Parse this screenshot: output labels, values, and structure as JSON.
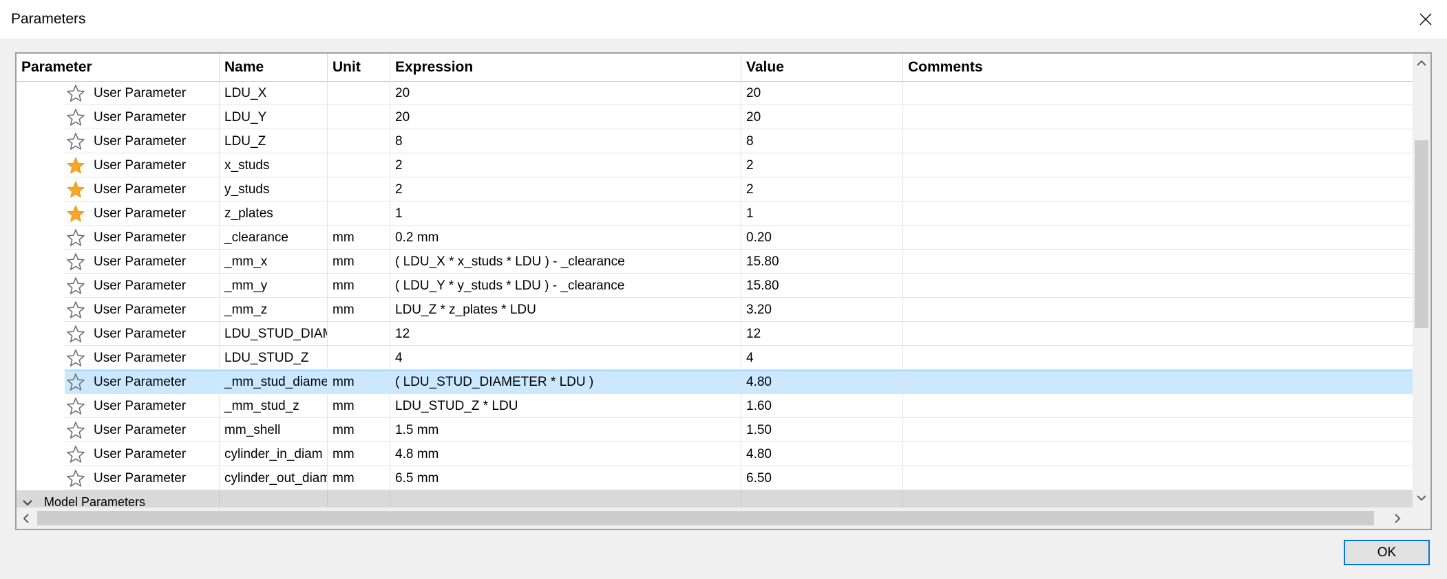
{
  "window": {
    "title": "Parameters"
  },
  "table": {
    "columns": [
      "Parameter",
      "Name",
      "Unit",
      "Expression",
      "Value",
      "Comments"
    ],
    "rows": [
      {
        "favorite": false,
        "type": "User Parameter",
        "name": "LDU_X",
        "unit": "",
        "expression": "20",
        "value": "20",
        "comments": ""
      },
      {
        "favorite": false,
        "type": "User Parameter",
        "name": "LDU_Y",
        "unit": "",
        "expression": "20",
        "value": "20",
        "comments": ""
      },
      {
        "favorite": false,
        "type": "User Parameter",
        "name": "LDU_Z",
        "unit": "",
        "expression": "8",
        "value": "8",
        "comments": ""
      },
      {
        "favorite": true,
        "type": "User Parameter",
        "name": "x_studs",
        "unit": "",
        "expression": "2",
        "value": "2",
        "comments": ""
      },
      {
        "favorite": true,
        "type": "User Parameter",
        "name": "y_studs",
        "unit": "",
        "expression": "2",
        "value": "2",
        "comments": ""
      },
      {
        "favorite": true,
        "type": "User Parameter",
        "name": "z_plates",
        "unit": "",
        "expression": "1",
        "value": "1",
        "comments": ""
      },
      {
        "favorite": false,
        "type": "User Parameter",
        "name": "_clearance",
        "unit": "mm",
        "expression": "0.2 mm",
        "value": "0.20",
        "comments": ""
      },
      {
        "favorite": false,
        "type": "User Parameter",
        "name": "_mm_x",
        "unit": "mm",
        "expression": "( LDU_X * x_studs * LDU ) - _clearance",
        "value": "15.80",
        "comments": ""
      },
      {
        "favorite": false,
        "type": "User Parameter",
        "name": "_mm_y",
        "unit": "mm",
        "expression": "( LDU_Y * y_studs * LDU ) - _clearance",
        "value": "15.80",
        "comments": ""
      },
      {
        "favorite": false,
        "type": "User Parameter",
        "name": "_mm_z",
        "unit": "mm",
        "expression": "LDU_Z * z_plates * LDU",
        "value": "3.20",
        "comments": ""
      },
      {
        "favorite": false,
        "type": "User Parameter",
        "name": "LDU_STUD_DIAMET...",
        "unit": "",
        "expression": "12",
        "value": "12",
        "comments": ""
      },
      {
        "favorite": false,
        "type": "User Parameter",
        "name": "LDU_STUD_Z",
        "unit": "",
        "expression": "4",
        "value": "4",
        "comments": ""
      },
      {
        "favorite": false,
        "type": "User Parameter",
        "name": "_mm_stud_diameter",
        "unit": "mm",
        "expression": "( LDU_STUD_DIAMETER * LDU )",
        "value": "4.80",
        "comments": "",
        "selected": true
      },
      {
        "favorite": false,
        "type": "User Parameter",
        "name": "_mm_stud_z",
        "unit": "mm",
        "expression": "LDU_STUD_Z * LDU",
        "value": "1.60",
        "comments": ""
      },
      {
        "favorite": false,
        "type": "User Parameter",
        "name": "mm_shell",
        "unit": "mm",
        "expression": "1.5 mm",
        "value": "1.50",
        "comments": ""
      },
      {
        "favorite": false,
        "type": "User Parameter",
        "name": "cylinder_in_diam",
        "unit": "mm",
        "expression": "4.8 mm",
        "value": "4.80",
        "comments": ""
      },
      {
        "favorite": false,
        "type": "User Parameter",
        "name": "cylinder_out_diam",
        "unit": "mm",
        "expression": "6.5 mm",
        "value": "6.50",
        "comments": ""
      }
    ],
    "group": {
      "label": "Model Parameters"
    }
  },
  "footer": {
    "ok_label": "OK"
  },
  "colors": {
    "star_active": "#f9a825",
    "selection": "#cce8ff",
    "accent": "#0078d7"
  },
  "icons": {
    "favorite": "star-icon",
    "close": "close-icon",
    "expand": "chevron-down-icon"
  }
}
